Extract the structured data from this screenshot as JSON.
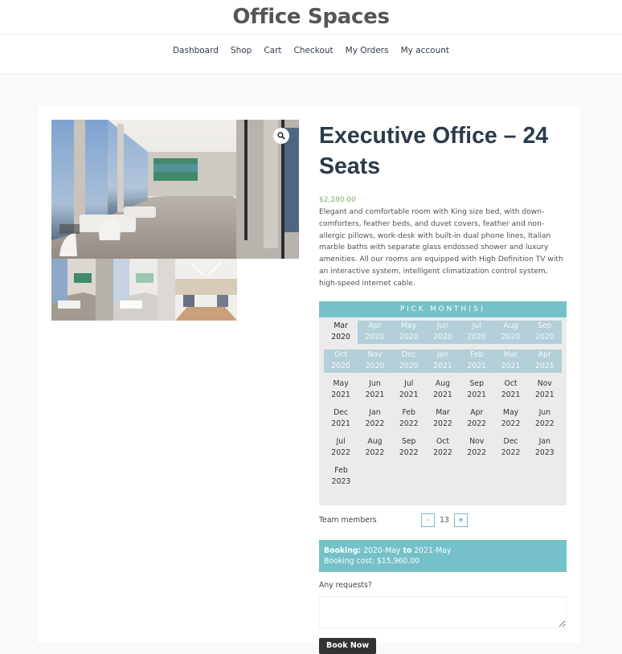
{
  "site": {
    "title": "Office Spaces"
  },
  "nav": {
    "items": [
      {
        "label": "Dashboard"
      },
      {
        "label": "Shop"
      },
      {
        "label": "Cart"
      },
      {
        "label": "Checkout"
      },
      {
        "label": "My Orders"
      },
      {
        "label": "My account"
      }
    ]
  },
  "gallery": {
    "zoom_icon": "magnifier-icon",
    "main_image": "executive-office-lounge-photo",
    "thumbnails": [
      "lounge-thumbnail",
      "lounge-bright-thumbnail",
      "conference-room-thumbnail"
    ]
  },
  "product": {
    "title": "Executive Office – 24 Seats",
    "price": "$2,280.00",
    "description": "Elegant and comfortable room with King size bed, with down-comforters, feather beds, and duvet covers, feather and non-allergic pillows, work-desk with built-in dual phone lines, Italian marble baths with separate glass endossed shower and luxury amenities. All our rooms are equipped with High Definition TV with an interactive system, intelligent climatization control system, high-speed internet cable."
  },
  "month_picker": {
    "header": "PICK MONTH(S)",
    "months": [
      {
        "m": "Mar",
        "y": "2020",
        "state": "current"
      },
      {
        "m": "Apr",
        "y": "2020",
        "state": "selected"
      },
      {
        "m": "May",
        "y": "2020",
        "state": "selected"
      },
      {
        "m": "Jun",
        "y": "2020",
        "state": "selected"
      },
      {
        "m": "Jul",
        "y": "2020",
        "state": "selected"
      },
      {
        "m": "Aug",
        "y": "2020",
        "state": "selected"
      },
      {
        "m": "Sep",
        "y": "2020",
        "state": "selected"
      },
      {
        "m": "Oct",
        "y": "2020",
        "state": "selected"
      },
      {
        "m": "Nov",
        "y": "2020",
        "state": "selected"
      },
      {
        "m": "Dec",
        "y": "2020",
        "state": "selected"
      },
      {
        "m": "Jan",
        "y": "2021",
        "state": "selected"
      },
      {
        "m": "Feb",
        "y": "2021",
        "state": "selected"
      },
      {
        "m": "Mar",
        "y": "2021",
        "state": "selected"
      },
      {
        "m": "Apr",
        "y": "2021",
        "state": "selected"
      },
      {
        "m": "May",
        "y": "2021",
        "state": ""
      },
      {
        "m": "Jun",
        "y": "2021",
        "state": ""
      },
      {
        "m": "Jul",
        "y": "2021",
        "state": ""
      },
      {
        "m": "Aug",
        "y": "2021",
        "state": ""
      },
      {
        "m": "Sep",
        "y": "2021",
        "state": ""
      },
      {
        "m": "Oct",
        "y": "2021",
        "state": ""
      },
      {
        "m": "Nov",
        "y": "2021",
        "state": ""
      },
      {
        "m": "Dec",
        "y": "2021",
        "state": ""
      },
      {
        "m": "Jan",
        "y": "2022",
        "state": ""
      },
      {
        "m": "Feb",
        "y": "2022",
        "state": ""
      },
      {
        "m": "Mar",
        "y": "2022",
        "state": ""
      },
      {
        "m": "Apr",
        "y": "2022",
        "state": ""
      },
      {
        "m": "May",
        "y": "2022",
        "state": ""
      },
      {
        "m": "Jun",
        "y": "2022",
        "state": ""
      },
      {
        "m": "Jul",
        "y": "2022",
        "state": ""
      },
      {
        "m": "Aug",
        "y": "2022",
        "state": ""
      },
      {
        "m": "Sep",
        "y": "2022",
        "state": ""
      },
      {
        "m": "Oct",
        "y": "2022",
        "state": ""
      },
      {
        "m": "Nov",
        "y": "2022",
        "state": ""
      },
      {
        "m": "Dec",
        "y": "2022",
        "state": ""
      },
      {
        "m": "Jan",
        "y": "2023",
        "state": ""
      },
      {
        "m": "Feb",
        "y": "2023",
        "state": ""
      }
    ]
  },
  "team": {
    "label": "Team members",
    "minus": "-",
    "value": "13",
    "plus": "+"
  },
  "booking": {
    "label": "Booking:",
    "from": "2020-May",
    "to_label": "to",
    "to": "2021-May",
    "cost_label": "Booking cost:",
    "cost": "$15,960.00"
  },
  "requests": {
    "label": "Any requests?",
    "value": "",
    "placeholder": ""
  },
  "book_button": {
    "label": "Book Now"
  },
  "colors": {
    "accent_teal": "#74c1c7",
    "selected_month": "#b3cfd8",
    "price_green": "#7bb264",
    "title_navy": "#2c3b4b",
    "button_dark": "#333333"
  }
}
